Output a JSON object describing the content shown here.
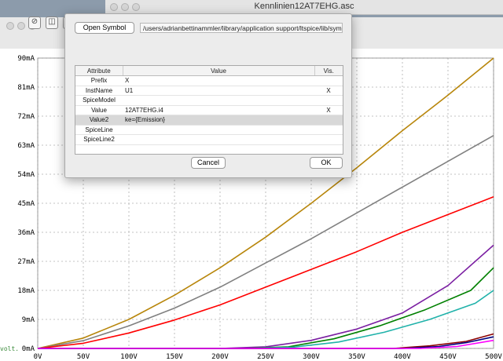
{
  "schematic_window": {
    "title": "Kennlinien12AT7EHG.asc"
  },
  "plot_window": {
    "toolbar_icons": [
      "zoom-icon",
      "chart-icon",
      "probe-icon"
    ],
    "side_text": "volt."
  },
  "dialog": {
    "open_symbol_label": "Open Symbol",
    "symbol_path": "/users/adrianbettinammler/library/application support/ltspice/lib/sym",
    "columns": [
      "Attribute",
      "Value",
      "Vis."
    ],
    "rows": [
      {
        "attribute": "Prefix",
        "value": "X",
        "vis": ""
      },
      {
        "attribute": "InstName",
        "value": "U1",
        "vis": "X"
      },
      {
        "attribute": "SpiceModel",
        "value": "",
        "vis": ""
      },
      {
        "attribute": "Value",
        "value": "12AT7EHG.i4",
        "vis": "X"
      },
      {
        "attribute": "Value2",
        "value": "ke={Emission}",
        "vis": ""
      },
      {
        "attribute": "SpiceLine",
        "value": "",
        "vis": ""
      },
      {
        "attribute": "SpiceLine2",
        "value": "",
        "vis": ""
      }
    ],
    "selected_row": 4,
    "cancel_label": "Cancel",
    "ok_label": "OK"
  },
  "chart_data": {
    "type": "line",
    "x_ticks": [
      "0V",
      "50V",
      "100V",
      "150V",
      "200V",
      "250V",
      "300V",
      "350V",
      "400V",
      "450V",
      "500V"
    ],
    "y_ticks": [
      "0mA",
      "9mA",
      "18mA",
      "27mA",
      "36mA",
      "45mA",
      "54mA",
      "63mA",
      "72mA",
      "81mA",
      "90mA"
    ],
    "xlim": [
      0,
      500
    ],
    "ylim": [
      0,
      90
    ],
    "grid": true,
    "series": [
      {
        "color": "#b8860b",
        "points": [
          [
            0,
            0
          ],
          [
            50,
            3.2
          ],
          [
            100,
            9
          ],
          [
            150,
            16.5
          ],
          [
            200,
            25
          ],
          [
            250,
            34.5
          ],
          [
            300,
            45
          ],
          [
            350,
            56
          ],
          [
            400,
            67.5
          ],
          [
            450,
            78.5
          ],
          [
            500,
            90
          ]
        ]
      },
      {
        "color": "#808080",
        "points": [
          [
            0,
            0
          ],
          [
            50,
            2.4
          ],
          [
            100,
            7
          ],
          [
            150,
            12.5
          ],
          [
            200,
            19
          ],
          [
            250,
            26.5
          ],
          [
            300,
            34
          ],
          [
            350,
            42
          ],
          [
            400,
            50
          ],
          [
            450,
            58
          ],
          [
            500,
            66
          ]
        ]
      },
      {
        "color": "#ff0000",
        "points": [
          [
            0,
            0
          ],
          [
            50,
            1.6
          ],
          [
            100,
            4.8
          ],
          [
            150,
            8.8
          ],
          [
            200,
            13.5
          ],
          [
            250,
            19
          ],
          [
            300,
            24.5
          ],
          [
            350,
            30
          ],
          [
            400,
            36
          ],
          [
            450,
            41.5
          ],
          [
            500,
            47
          ]
        ]
      },
      {
        "color": "#7b1fa2",
        "points": [
          [
            0,
            0
          ],
          [
            200,
            0
          ],
          [
            250,
            0.5
          ],
          [
            300,
            2.5
          ],
          [
            350,
            6
          ],
          [
            400,
            11
          ],
          [
            450,
            19.5
          ],
          [
            500,
            32
          ]
        ]
      },
      {
        "color": "#008000",
        "points": [
          [
            0,
            0
          ],
          [
            225,
            0
          ],
          [
            275,
            0.5
          ],
          [
            325,
            3
          ],
          [
            375,
            7
          ],
          [
            425,
            12
          ],
          [
            475,
            18
          ],
          [
            500,
            25
          ]
        ]
      },
      {
        "color": "#20b2aa",
        "points": [
          [
            0,
            0
          ],
          [
            230,
            0
          ],
          [
            280,
            0.4
          ],
          [
            330,
            2
          ],
          [
            380,
            5
          ],
          [
            430,
            9
          ],
          [
            480,
            14
          ],
          [
            500,
            18
          ]
        ]
      },
      {
        "color": "#8b0000",
        "points": [
          [
            0,
            0
          ],
          [
            390,
            0
          ],
          [
            430,
            0.8
          ],
          [
            470,
            2.2
          ],
          [
            500,
            4.5
          ]
        ]
      },
      {
        "color": "#000080",
        "points": [
          [
            0,
            0
          ],
          [
            400,
            0
          ],
          [
            440,
            0.6
          ],
          [
            470,
            1.8
          ],
          [
            500,
            3.6
          ]
        ]
      },
      {
        "color": "#ff00ff",
        "points": [
          [
            0,
            0
          ],
          [
            420,
            0
          ],
          [
            460,
            0.6
          ],
          [
            500,
            2.5
          ]
        ]
      }
    ]
  }
}
